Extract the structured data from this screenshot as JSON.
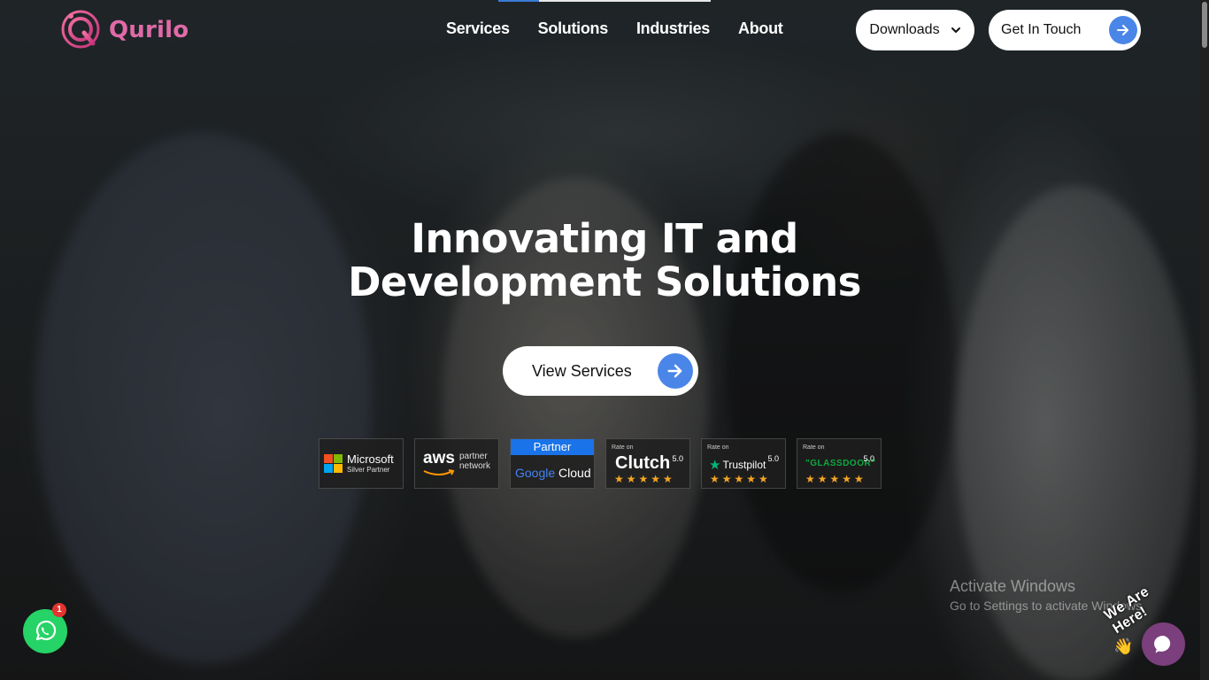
{
  "brand": {
    "name": "Qurilo",
    "color": "#e06aa8"
  },
  "nav": {
    "items": [
      {
        "label": "Services"
      },
      {
        "label": "Solutions"
      },
      {
        "label": "Industries"
      },
      {
        "label": "About"
      }
    ]
  },
  "header": {
    "downloads_label": "Downloads",
    "downloads_icon": "chevron-down-icon",
    "contact_label": "Get In Touch",
    "contact_icon": "arrow-right-icon",
    "accent_color": "#4a86e8"
  },
  "hero": {
    "title_line1": "Innovating IT and",
    "title_line2": "Development Solutions",
    "cta_label": "View Services",
    "cta_icon": "arrow-right-icon"
  },
  "badges": {
    "microsoft": {
      "name": "Microsoft",
      "sub": "Silver Partner"
    },
    "aws": {
      "name": "aws",
      "sub_line1": "partner",
      "sub_line2": "network"
    },
    "google": {
      "top": "Partner",
      "name_google": "Google",
      "name_cloud": "Cloud"
    },
    "clutch": {
      "rate_on": "Rate on",
      "name": "Clutch",
      "score": "5.0",
      "stars": "★★★★★"
    },
    "trustpilot": {
      "rate_on": "Rate on",
      "name": "Trustpilot",
      "score": "5.0",
      "stars": "★★★★★"
    },
    "glassdoor": {
      "rate_on": "Rate on",
      "name": "\"GLASSDOOR\"",
      "score": "5.0",
      "stars": "★★★★★"
    }
  },
  "system": {
    "activate_title": "Activate Windows",
    "activate_sub": "Go to Settings to activate Windows."
  },
  "widgets": {
    "whatsapp_count": "1",
    "whatsapp_icon": "whatsapp-icon",
    "chat_label": "We Are Here!",
    "wave_icon": "waving-hand-icon",
    "chat_icon": "chat-bubble-icon",
    "whatsapp_color": "#25d366",
    "chat_color": "#7a3f7c"
  }
}
